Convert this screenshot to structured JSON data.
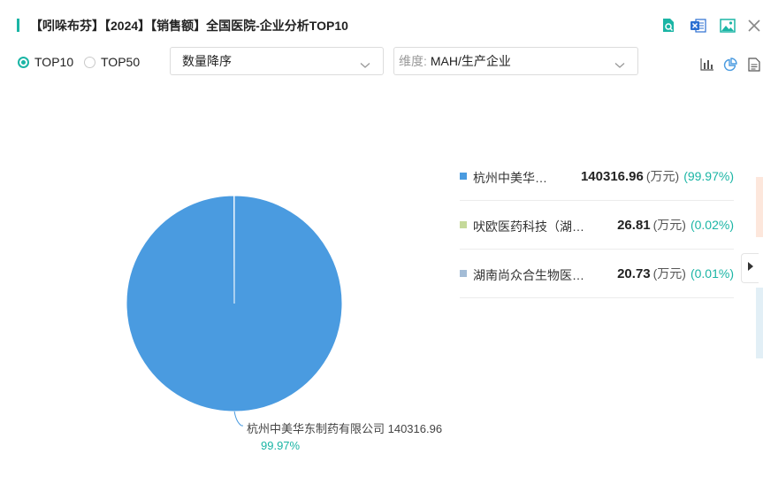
{
  "header": {
    "title": "【吲哚布芬】【2024】【销售额】全国医院-企业分析TOP10",
    "icons": [
      "search-doc-icon",
      "excel-icon",
      "image-icon",
      "close-icon"
    ]
  },
  "controls": {
    "radios": [
      {
        "label": "TOP10",
        "selected": true
      },
      {
        "label": "TOP50",
        "selected": false
      }
    ],
    "sort_select": {
      "value": "数量降序"
    },
    "dimension_select": {
      "prefix": "维度:",
      "value": "MAH/生产企业"
    },
    "view_icons": [
      "bar-chart-icon",
      "pie-chart-icon",
      "document-icon"
    ]
  },
  "colors": {
    "accent": "#1bb5a5",
    "series": [
      "#4a9be0",
      "#c5d99a",
      "#a3bcd6"
    ]
  },
  "chart_data": {
    "type": "pie",
    "unit": "(万元)",
    "categories": [
      "杭州中美华东制药有限公司",
      "吠欧医药科技（湖…",
      "湖南尚众合生物医…"
    ],
    "legend_labels": [
      "杭州中美华…",
      "吠欧医药科技（湖…",
      "湖南尚众合生物医…"
    ],
    "values": [
      140316.96,
      26.81,
      20.73
    ],
    "value_labels": [
      "140316.96",
      "26.81",
      "20.73"
    ],
    "percents": [
      "(99.97%)",
      "(0.02%)",
      "(0.01%)"
    ],
    "callout": {
      "label": "杭州中美华东制药有限公司 140316.96",
      "percent": "99.97%"
    },
    "legend_position": "right"
  }
}
